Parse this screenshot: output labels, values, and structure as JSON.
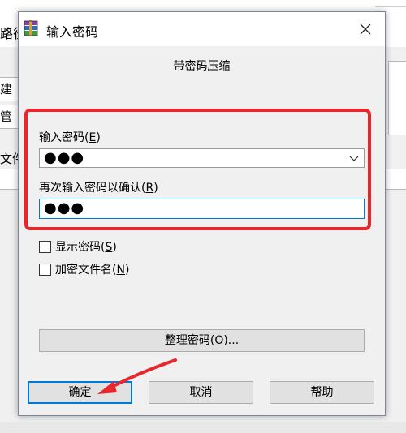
{
  "background": {
    "title_fragment": "路径",
    "left_tab1": "建默",
    "left_tab2": "管理",
    "left_file_label": "文件"
  },
  "dialog": {
    "title": "输入密码",
    "heading": "带密码压缩",
    "password_label": "输入密码(",
    "password_label_key": "E",
    "password_label_end": ")",
    "password_value": "●●●",
    "confirm_label": "再次输入密码以确认(",
    "confirm_label_key": "R",
    "confirm_label_end": ")",
    "confirm_value": "●●●",
    "show_password_label": "显示密码(",
    "show_password_key": "S",
    "show_password_end": ")",
    "encrypt_filenames_label": "加密文件名(",
    "encrypt_filenames_key": "N",
    "encrypt_filenames_end": ")",
    "organize_button": "整理密码(",
    "organize_button_key": "O",
    "organize_button_end": ")...",
    "ok_button": "确定",
    "cancel_button": "取消",
    "help_button": "帮助"
  },
  "colors": {
    "highlight": "#e8262b",
    "focus": "#0078d7"
  },
  "icons": {
    "app": "winrar-icon",
    "close": "close-icon",
    "dropdown": "chevron-down-icon"
  }
}
